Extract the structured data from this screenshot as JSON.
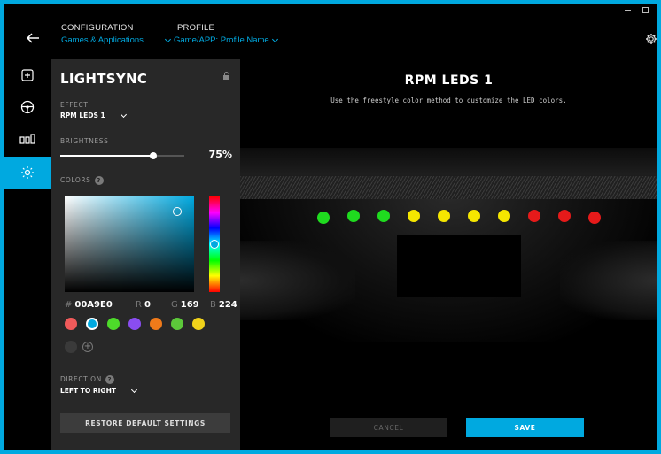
{
  "header": {
    "configuration_title": "CONFIGURATION",
    "configuration_value": "Games & Applications",
    "profile_title": "PROFILE",
    "profile_value": "Game/APP: Profile Name"
  },
  "rail": {
    "items": [
      {
        "icon": "add-icon",
        "active": false
      },
      {
        "icon": "steering-wheel-icon",
        "active": false
      },
      {
        "icon": "pedals-icon",
        "active": false
      },
      {
        "icon": "lightsync-icon",
        "active": true
      }
    ]
  },
  "panel": {
    "title": "LIGHTSYNC",
    "effect_label": "EFFECT",
    "effect_value": "RPM LEDS 1",
    "brightness_label": "BRIGHTNESS",
    "brightness_value": "75%",
    "brightness_level": 0.75,
    "colors_label": "COLORS",
    "help_glyph": "?",
    "hex_prefix": "#",
    "hex_value": "00A9E0",
    "r_label": "R",
    "r_value": "0",
    "g_label": "G",
    "g_value": "169",
    "b_label": "B",
    "b_value": "224",
    "swatches": [
      "#F05A5A",
      "#00A9E0",
      "#4DDB2A",
      "#8A4DF0",
      "#F07A1A",
      "#5CC83A",
      "#F0D21A",
      "#3A3A3A"
    ],
    "selected_swatch": 1,
    "add_glyph": "+",
    "direction_label": "DIRECTION",
    "direction_value": "LEFT TO RIGHT",
    "restore_label": "RESTORE DEFAULT SETTINGS"
  },
  "main": {
    "title": "RPM LEDS 1",
    "subtitle": "Use the freestyle color method to customize the LED colors.",
    "leds": [
      "#1FDB1F",
      "#1FDB1F",
      "#1FDB1F",
      "#F5E600",
      "#F5E600",
      "#F5E600",
      "#F5E600",
      "#E61A1A",
      "#E61A1A",
      "#E61A1A"
    ],
    "cancel_label": "CANCEL",
    "save_label": "SAVE"
  },
  "colors": {
    "accent": "#00A9E0",
    "panel_bg": "#282828"
  }
}
